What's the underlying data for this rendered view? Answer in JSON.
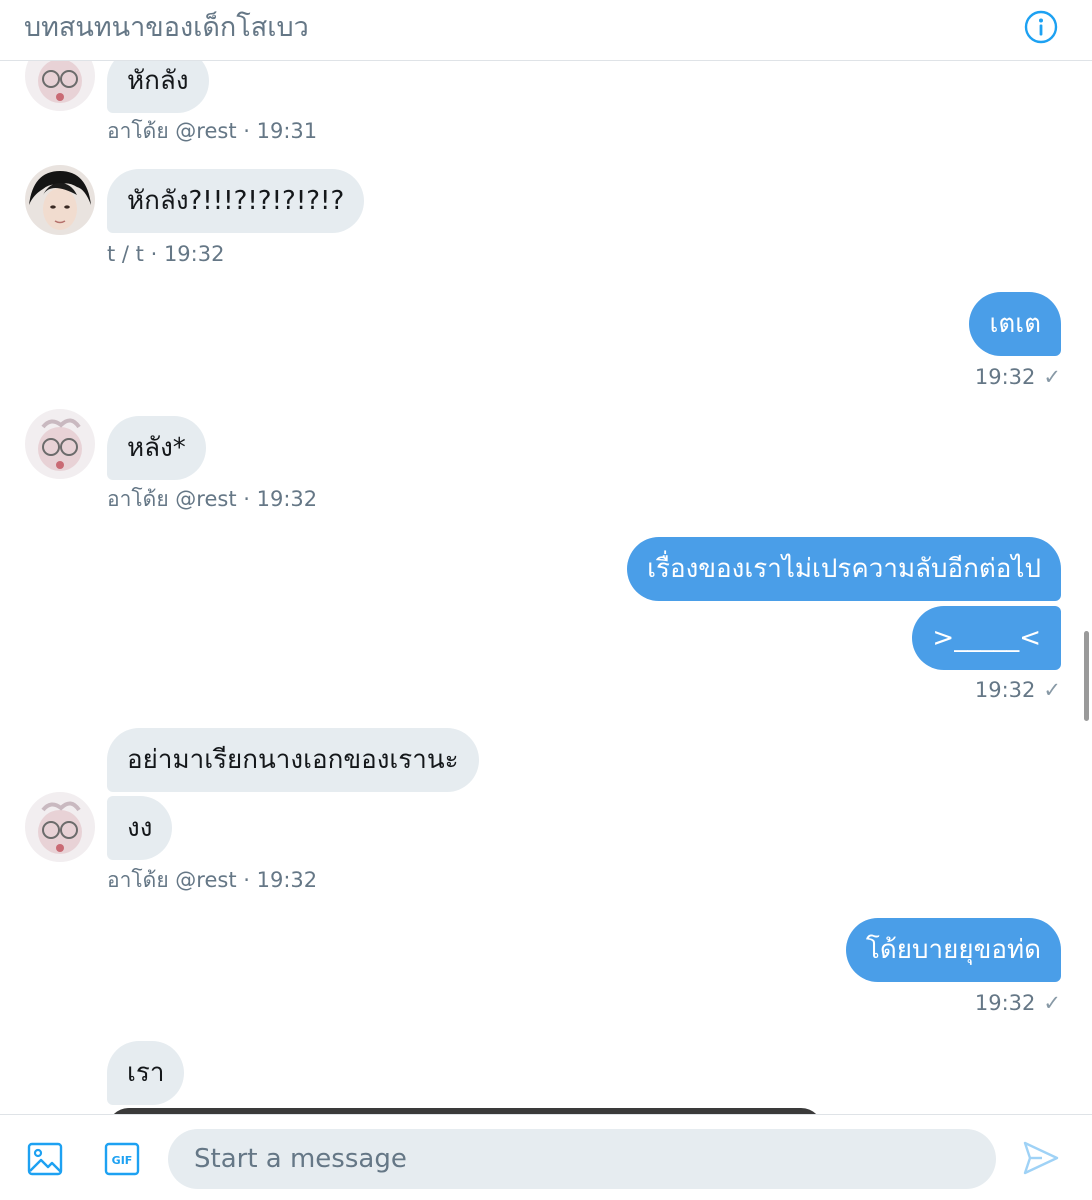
{
  "header": {
    "title": "บทสนทนาของเด็กโสเบว",
    "info_icon": "info-icon"
  },
  "messages": {
    "m1": {
      "text": "หักลัง",
      "sender": "อาโด้ย @rest",
      "time": "· 19:31"
    },
    "m2": {
      "text": "หักลัง?!!!?!?!?!?!?",
      "sender": "t / t",
      "time": "· 19:32"
    },
    "m3": {
      "text": "เตเต",
      "time": "19:32"
    },
    "m4": {
      "text": "หลัง*",
      "sender": "อาโด้ย @rest",
      "time": "· 19:32"
    },
    "m5": {
      "text": "เรื่องของเราไม่เปรความลับอีกต่อไป",
      "text2": ">_____<",
      "time": "19:32"
    },
    "m6": {
      "text": "อย่ามาเรียกนางเอกของเรานะ",
      "text2": "งง",
      "sender": "อาโด้ย @rest",
      "time": "· 19:32"
    },
    "m7": {
      "text": "โด้ยบายยุขอท่ด",
      "time": "19:32"
    },
    "m8": {
      "text": "เรา"
    },
    "check_mark": "✓"
  },
  "composer": {
    "placeholder": "Start a message",
    "image_icon": "image-icon",
    "gif_icon": "gif-icon",
    "gif_label": "GIF",
    "send_icon": "send-icon"
  },
  "colors": {
    "accent": "#1da1f2",
    "outgoing_bubble": "#4a9ee8",
    "incoming_bubble": "#e6ecf0",
    "meta_text": "#657786"
  }
}
